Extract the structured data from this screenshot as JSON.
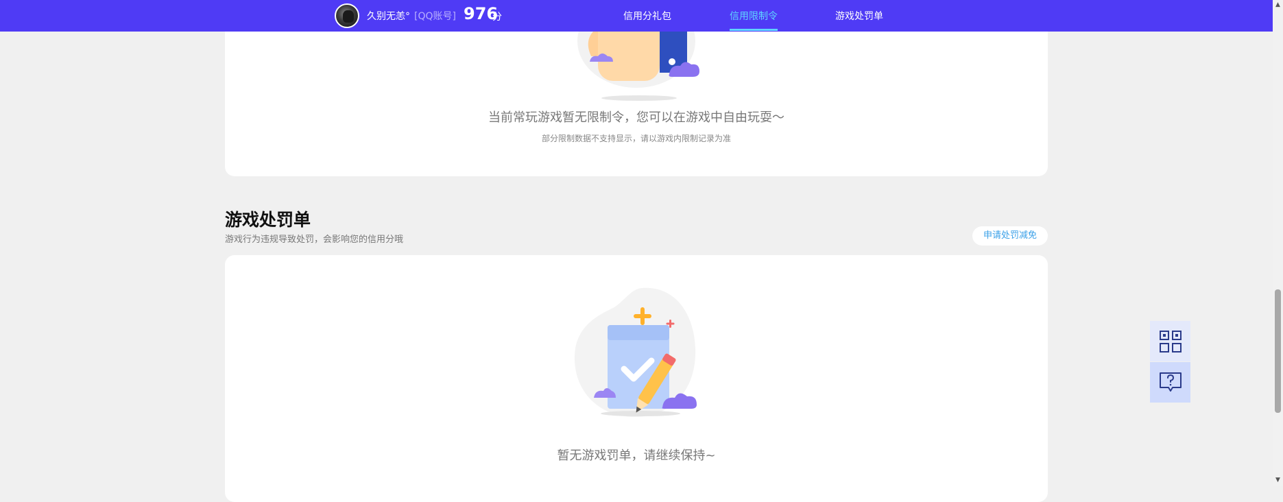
{
  "header": {
    "username": "久别无恙°",
    "account_tag": "[QQ账号]",
    "score": "976",
    "score_unit": "分",
    "nav": [
      {
        "label": "信用分礼包",
        "active": false
      },
      {
        "label": "信用限制令",
        "active": true
      },
      {
        "label": "游戏处罚单",
        "active": false
      }
    ]
  },
  "restriction_card": {
    "empty_message": "当前常玩游戏暂无限制令，您可以在游戏中自由玩耍～",
    "note": "部分限制数据不支持显示，请以游戏内限制记录为准"
  },
  "penalty_section": {
    "title": "游戏处罚单",
    "description": "游戏行为违规导致处罚，会影响您的信用分哦",
    "appeal_button": "申请处罚减免",
    "empty_message": "暂无游戏罚单，请继续保持~"
  },
  "floating_tools": [
    {
      "icon": "qr-code-icon"
    },
    {
      "icon": "help-chat-icon"
    }
  ],
  "colors": {
    "header_bg": "#4f3bf5",
    "nav_active": "#5fd4ff",
    "page_bg": "#f0f0f0",
    "appeal_text": "#3aa0e8"
  }
}
